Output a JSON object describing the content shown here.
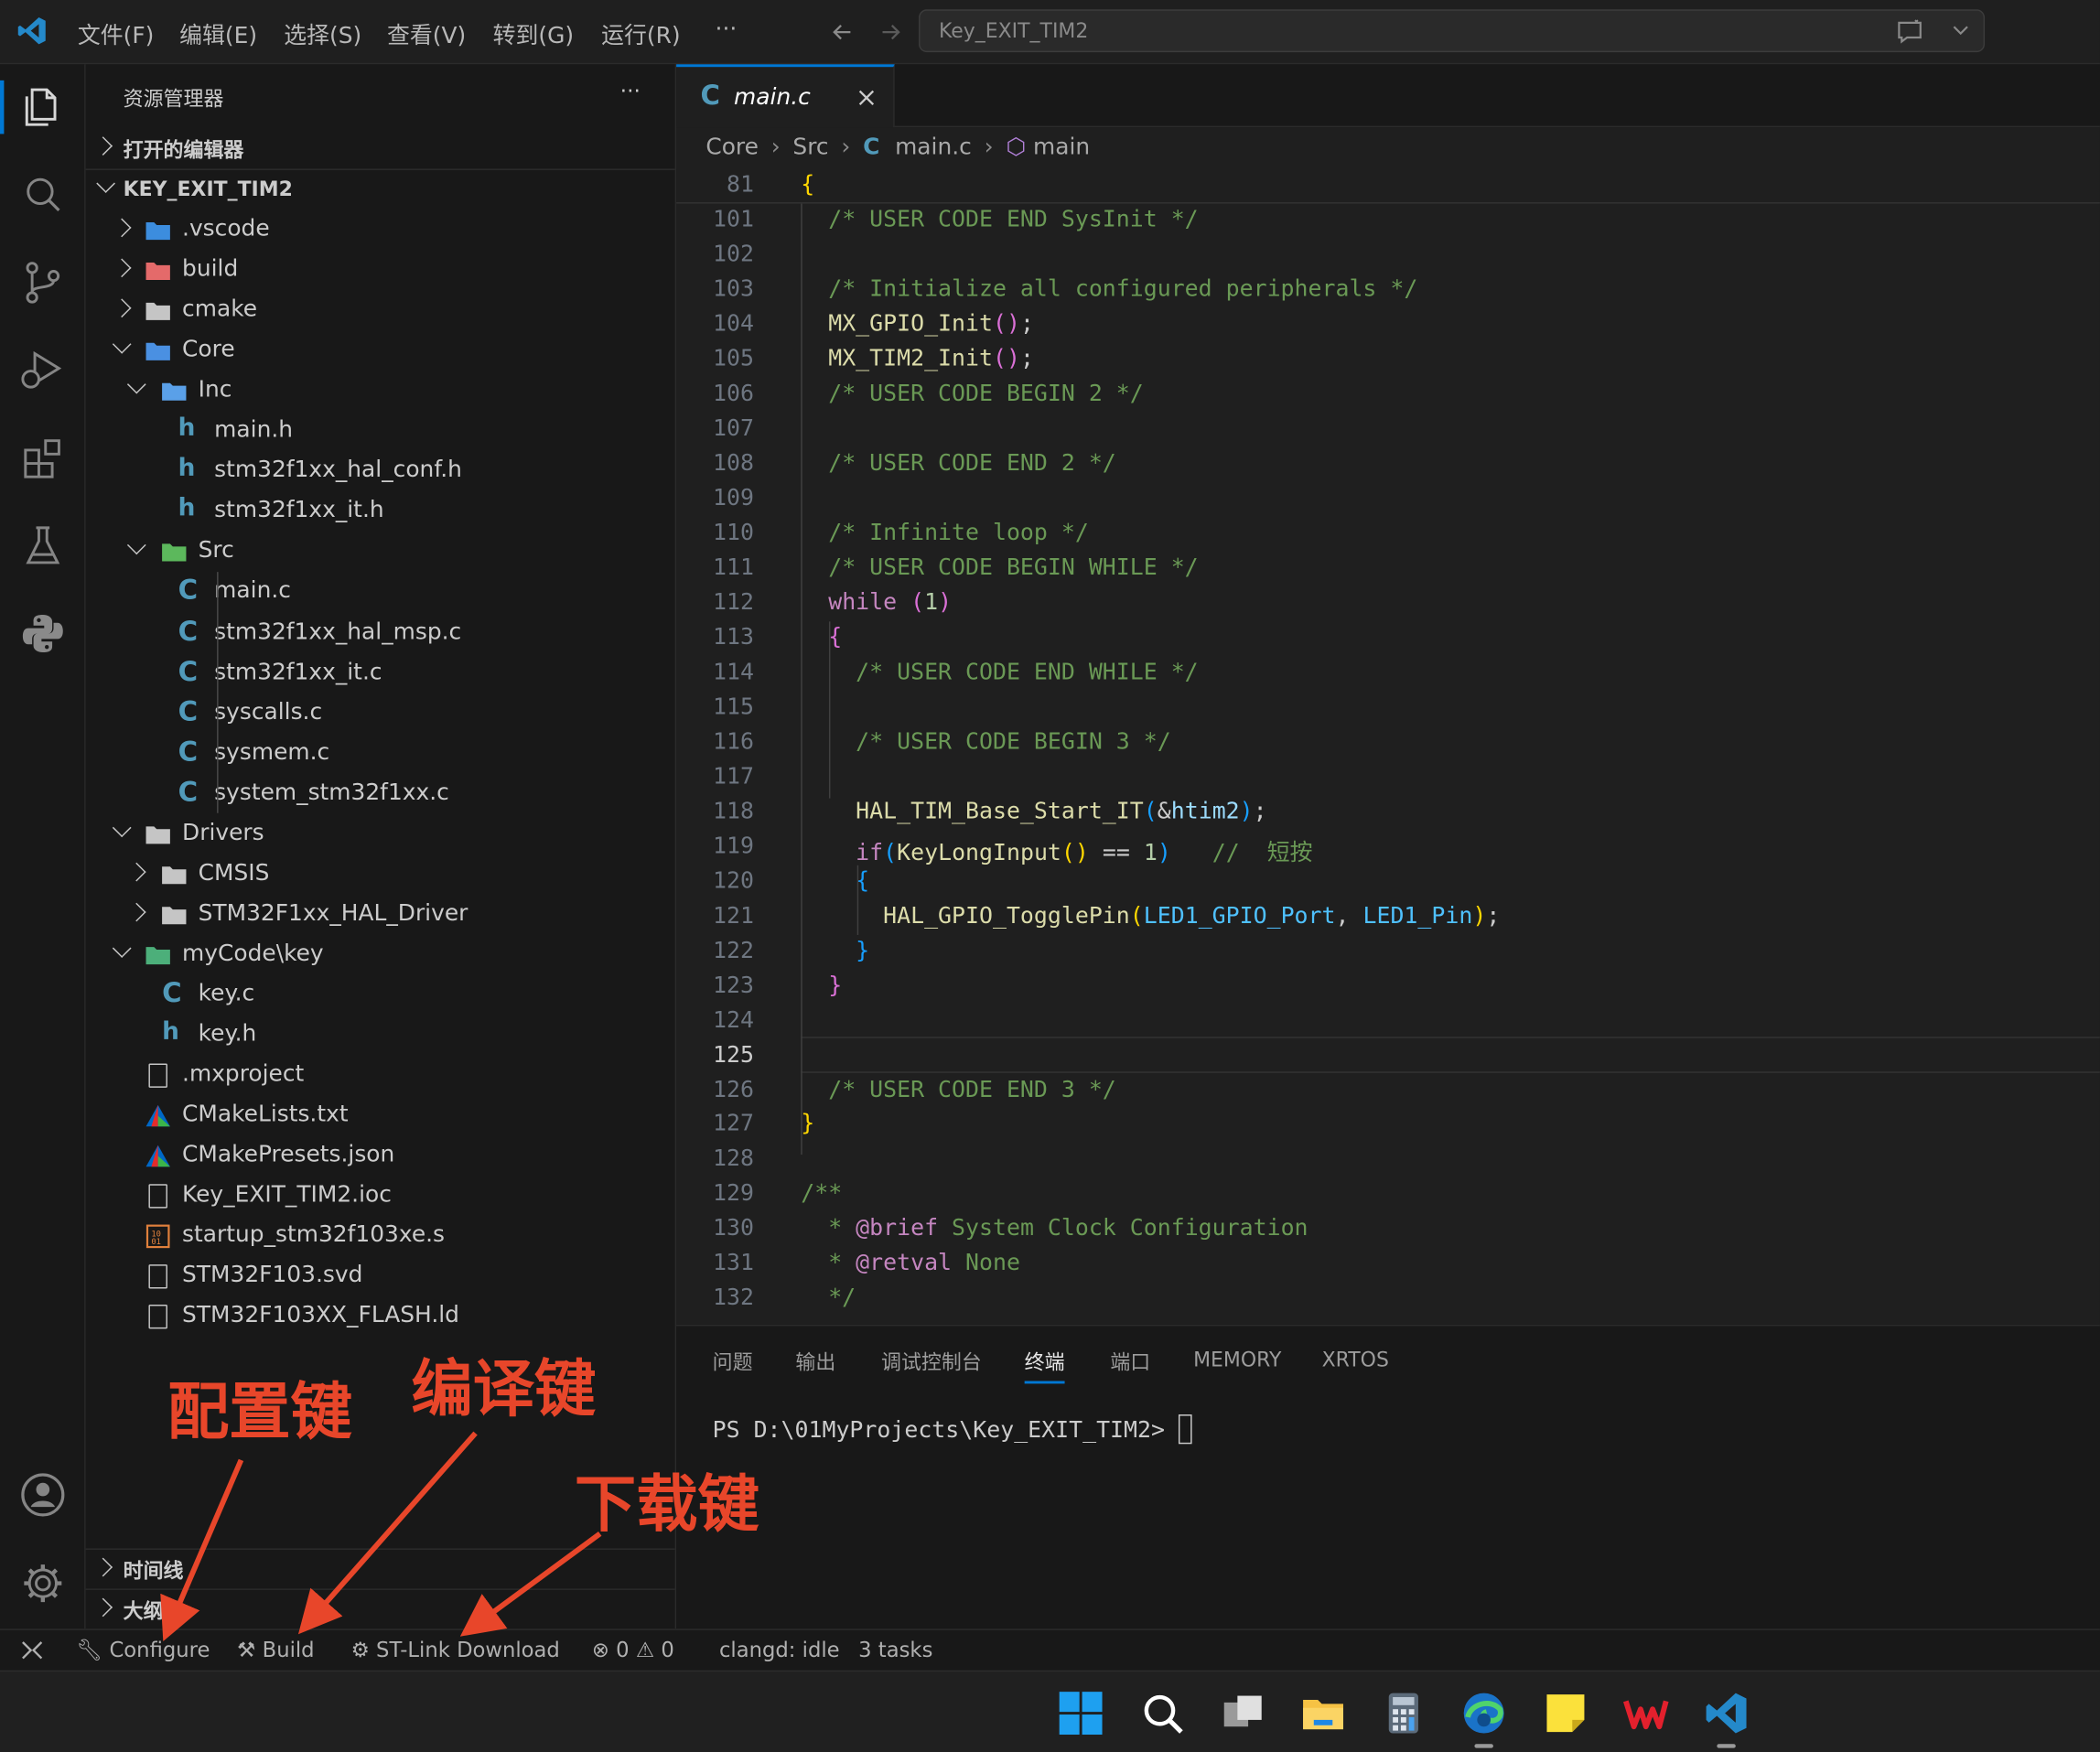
{
  "menu": [
    "文件(F)",
    "编辑(E)",
    "选择(S)",
    "查看(V)",
    "转到(G)",
    "运行(R)",
    "···"
  ],
  "search": {
    "text": "Key_EXIT_TIM2"
  },
  "sidebar": {
    "title": "资源管理器",
    "more": "···",
    "open_editors": "打开的编辑器",
    "project": "KEY_EXIT_TIM2",
    "tree": [
      {
        "label": ".vscode",
        "depth": 1,
        "chev": "r",
        "icon": "vscode-folder"
      },
      {
        "label": "build",
        "depth": 1,
        "chev": "r",
        "icon": "build-folder"
      },
      {
        "label": "cmake",
        "depth": 1,
        "chev": "r",
        "icon": "folder"
      },
      {
        "label": "Core",
        "depth": 1,
        "chev": "d",
        "icon": "core-folder"
      },
      {
        "label": "Inc",
        "depth": 2,
        "chev": "d",
        "icon": "inc-folder"
      },
      {
        "label": "main.h",
        "depth": 3,
        "icon": "h"
      },
      {
        "label": "stm32f1xx_hal_conf.h",
        "depth": 3,
        "icon": "h"
      },
      {
        "label": "stm32f1xx_it.h",
        "depth": 3,
        "icon": "h"
      },
      {
        "label": "Src",
        "depth": 2,
        "chev": "d",
        "icon": "src-folder"
      },
      {
        "label": "main.c",
        "depth": 3,
        "icon": "c"
      },
      {
        "label": "stm32f1xx_hal_msp.c",
        "depth": 3,
        "icon": "c"
      },
      {
        "label": "stm32f1xx_it.c",
        "depth": 3,
        "icon": "c"
      },
      {
        "label": "syscalls.c",
        "depth": 3,
        "icon": "c"
      },
      {
        "label": "sysmem.c",
        "depth": 3,
        "icon": "c"
      },
      {
        "label": "system_stm32f1xx.c",
        "depth": 3,
        "icon": "c"
      },
      {
        "label": "Drivers",
        "depth": 1,
        "chev": "d",
        "icon": "open-folder"
      },
      {
        "label": "CMSIS",
        "depth": 2,
        "chev": "r",
        "icon": "folder"
      },
      {
        "label": "STM32F1xx_HAL_Driver",
        "depth": 2,
        "chev": "r",
        "icon": "folder"
      },
      {
        "label": "myCode\\key",
        "depth": 1,
        "chev": "d",
        "icon": "code-folder"
      },
      {
        "label": "key.c",
        "depth": 2,
        "icon": "c"
      },
      {
        "label": "key.h",
        "depth": 2,
        "icon": "h"
      },
      {
        "label": ".mxproject",
        "depth": 1,
        "icon": "file"
      },
      {
        "label": "CMakeLists.txt",
        "depth": 1,
        "icon": "cmake"
      },
      {
        "label": "CMakePresets.json",
        "depth": 1,
        "icon": "cmake"
      },
      {
        "label": "Key_EXIT_TIM2.ioc",
        "depth": 1,
        "icon": "file"
      },
      {
        "label": "startup_stm32f103xe.s",
        "depth": 1,
        "icon": "asm"
      },
      {
        "label": "STM32F103.svd",
        "depth": 1,
        "icon": "file"
      },
      {
        "label": "STM32F103XX_FLASH.ld",
        "depth": 1,
        "icon": "file"
      }
    ],
    "timeline": "时间线",
    "outline": "大纲"
  },
  "editor": {
    "tab": "main.c",
    "breadcrumb": [
      "Core",
      "Src",
      "main.c",
      "main"
    ],
    "sticky_line": {
      "n": "81",
      "text": "{"
    },
    "lines": [
      {
        "n": "101",
        "html": "  <span class='c-cm'>/* USER CODE END SysInit */</span>"
      },
      {
        "n": "102",
        "html": ""
      },
      {
        "n": "103",
        "html": "  <span class='c-cm'>/* Initialize all configured peripherals */</span>"
      },
      {
        "n": "104",
        "html": "  <span class='c-fn'>MX_GPIO_Init</span><span class='c-br2'>()</span>;"
      },
      {
        "n": "105",
        "html": "  <span class='c-fn'>MX_TIM2_Init</span><span class='c-br2'>()</span>;"
      },
      {
        "n": "106",
        "html": "  <span class='c-cm'>/* USER CODE BEGIN 2 */</span>"
      },
      {
        "n": "107",
        "html": ""
      },
      {
        "n": "108",
        "html": "  <span class='c-cm'>/* USER CODE END 2 */</span>"
      },
      {
        "n": "109",
        "html": ""
      },
      {
        "n": "110",
        "html": "  <span class='c-cm'>/* Infinite loop */</span>"
      },
      {
        "n": "111",
        "html": "  <span class='c-cm'>/* USER CODE BEGIN WHILE */</span>"
      },
      {
        "n": "112",
        "html": "  <span class='c-kw'>while</span> <span class='c-br2'>(</span><span class='c-num'>1</span><span class='c-br2'>)</span>"
      },
      {
        "n": "113",
        "html": "  <span class='c-br2'>{</span>"
      },
      {
        "n": "114",
        "html": "    <span class='c-cm'>/* USER CODE END WHILE */</span>"
      },
      {
        "n": "115",
        "html": ""
      },
      {
        "n": "116",
        "html": "    <span class='c-cm'>/* USER CODE BEGIN 3 */</span>"
      },
      {
        "n": "117",
        "html": ""
      },
      {
        "n": "118",
        "html": "    <span class='c-fn'>HAL_TIM_Base_Start_IT</span><span class='c-br3'>(</span>&amp;<span class='c-var'>htim2</span><span class='c-br3'>)</span>;"
      },
      {
        "n": "119",
        "html": "    <span class='c-kw'>if</span><span class='c-br3'>(</span><span class='c-fn'>KeyLongInput</span><span class='c-br1'>()</span> == <span class='c-num'>1</span><span class='c-br3'>)</span>   <span class='c-cm'>//  短按</span>"
      },
      {
        "n": "120",
        "html": "    <span class='c-br3'>{</span>"
      },
      {
        "n": "121",
        "html": "      <span class='c-fn'>HAL_GPIO_TogglePin</span><span class='c-br1'>(</span><span class='c-macro'>LED1_GPIO_Port</span>, <span class='c-macro'>LED1_Pin</span><span class='c-br1'>)</span>;"
      },
      {
        "n": "122",
        "html": "    <span class='c-br3'>}</span>"
      },
      {
        "n": "123",
        "html": "  <span class='c-br2'>}</span>"
      },
      {
        "n": "124",
        "html": ""
      },
      {
        "n": "125",
        "html": "",
        "cur": true
      },
      {
        "n": "126",
        "html": "  <span class='c-cm'>/* USER CODE END 3 */</span>"
      },
      {
        "n": "127",
        "html": "<span class='c-br1'>}</span>"
      },
      {
        "n": "128",
        "html": ""
      },
      {
        "n": "129",
        "html": "<span class='c-cm'>/**</span>"
      },
      {
        "n": "130",
        "html": "<span class='c-cm'>  * </span><span class='c-kw'>@brief</span><span class='c-cm'> System Clock Configuration</span>"
      },
      {
        "n": "131",
        "html": "<span class='c-cm'>  * </span><span class='c-kw'>@retval</span><span class='c-cm'> None</span>"
      },
      {
        "n": "132",
        "html": "<span class='c-cm'>  */</span>"
      }
    ]
  },
  "panel": {
    "tabs": [
      "问题",
      "输出",
      "调试控制台",
      "终端",
      "端口",
      "MEMORY",
      "XRTOS"
    ],
    "active_tab": "终端",
    "terminal": "PS D:\\01MyProjects\\Key_EXIT_TIM2> "
  },
  "status": {
    "configure": "Configure",
    "build": "Build",
    "download": "ST-Link Download",
    "errors": "0",
    "warnings": "0",
    "clangd": "clangd: idle",
    "tasks": "3 tasks"
  },
  "annotations": {
    "configure": "配置键",
    "build": "编译键",
    "download": "下载键"
  },
  "colors": {
    "accent": "#0078d4",
    "annotation": "#e8462a",
    "background": "#1f1f1f"
  }
}
